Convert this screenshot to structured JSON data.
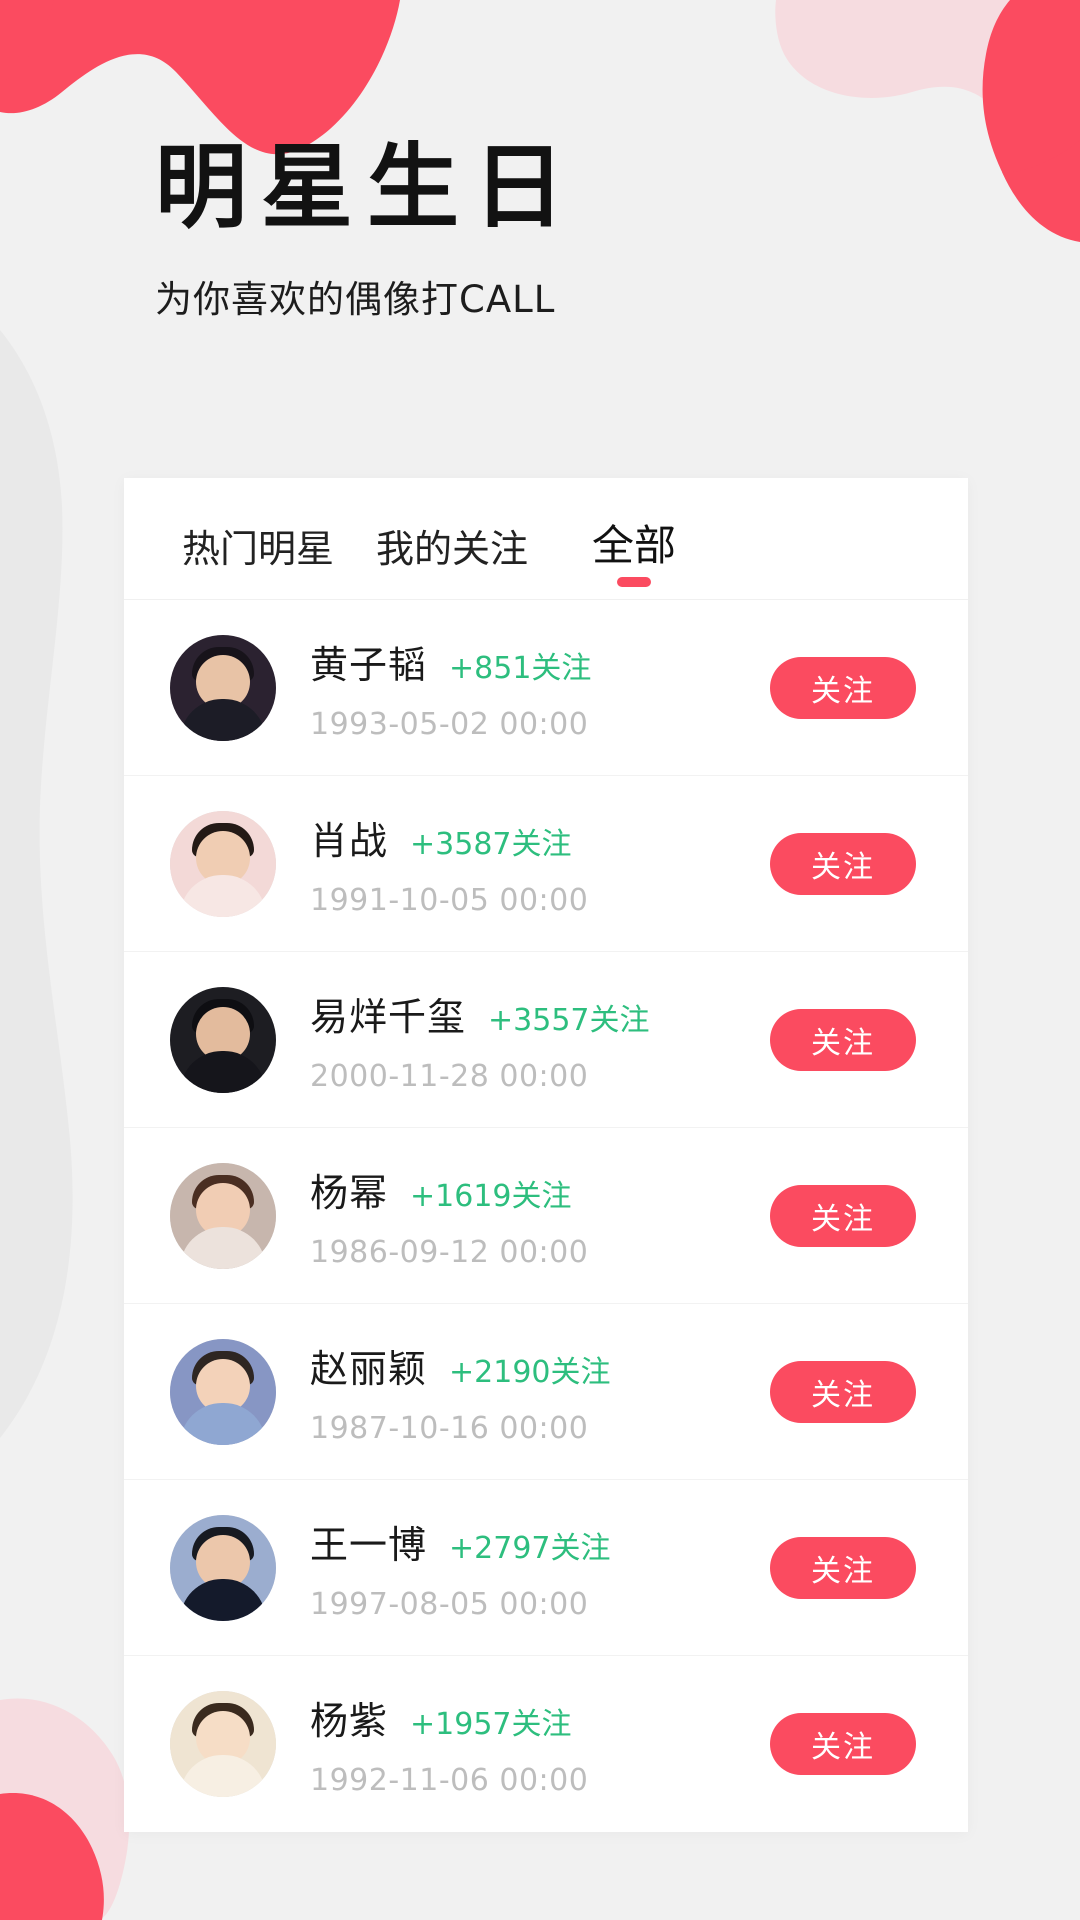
{
  "theme": {
    "accent_red": "#FB4B60",
    "accent_pink": "#F6DCE0",
    "follow_green": "#2DBE7E",
    "page_bg": "#F1F1F1",
    "card_bg": "#FFFFFF",
    "date_gray": "#BDBDBD"
  },
  "header": {
    "title": "明星生日",
    "subtitle": "为你喜欢的偶像打CALL"
  },
  "tabs": [
    {
      "label": "热门明星",
      "active": false
    },
    {
      "label": "我的关注",
      "active": false
    },
    {
      "label": "全部",
      "active": true
    }
  ],
  "list": {
    "follow_button_label": "关注",
    "rows": [
      {
        "name": "黄子韬",
        "follows": "+851关注",
        "date": "1993-05-02  00:00",
        "button": "关注",
        "avatar": {
          "bg": "#2b2230",
          "hair": "#17131a",
          "face": "#e8c3a6",
          "body": "#1c1c26"
        }
      },
      {
        "name": "肖战",
        "follows": "+3587关注",
        "date": "1991-10-05  00:00",
        "button": "关注",
        "avatar": {
          "bg": "#f3d9d7",
          "hair": "#241a16",
          "face": "#f0cdb3",
          "body": "#f7e7e4"
        }
      },
      {
        "name": "易烊千玺",
        "follows": "+3557关注",
        "date": "2000-11-28  00:00",
        "button": "关注",
        "avatar": {
          "bg": "#1d1d22",
          "hair": "#0e0e12",
          "face": "#e3bb9d",
          "body": "#15151b"
        }
      },
      {
        "name": "杨幂",
        "follows": "+1619关注",
        "date": "1986-09-12  00:00",
        "button": "关注",
        "avatar": {
          "bg": "#c7b6ad",
          "hair": "#4a2e22",
          "face": "#f1cdb4",
          "body": "#ece2dc"
        }
      },
      {
        "name": "赵丽颖",
        "follows": "+2190关注",
        "date": "1987-10-16  00:00",
        "button": "关注",
        "avatar": {
          "bg": "#8796c4",
          "hair": "#2e2622",
          "face": "#f3d2b9",
          "body": "#8fa7d2"
        }
      },
      {
        "name": "王一博",
        "follows": "+2797关注",
        "date": "1997-08-05  00:00",
        "button": "关注",
        "avatar": {
          "bg": "#9badcf",
          "hair": "#171a21",
          "face": "#ecc7ab",
          "body": "#141a2b"
        }
      },
      {
        "name": "杨紫",
        "follows": "+1957关注",
        "date": "1992-11-06  00:00",
        "button": "关注",
        "avatar": {
          "bg": "#efe4d2",
          "hair": "#3a2a1e",
          "face": "#f6ddc6",
          "body": "#f7efe3"
        }
      }
    ]
  }
}
